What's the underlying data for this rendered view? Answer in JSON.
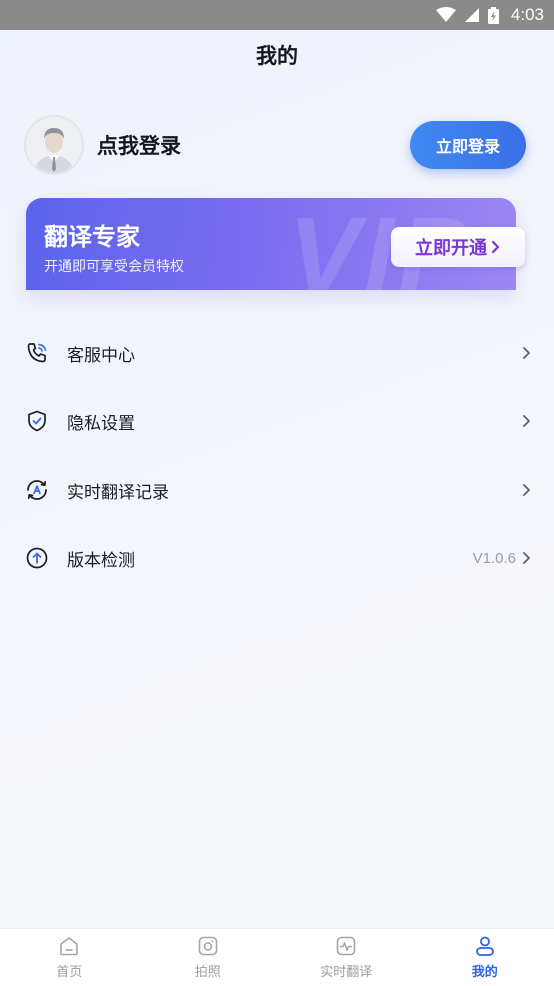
{
  "status_bar": {
    "time": "4:03"
  },
  "page": {
    "title": "我的"
  },
  "profile": {
    "login_prompt": "点我登录",
    "login_button": "立即登录"
  },
  "vip": {
    "title": "翻译专家",
    "subtitle": "开通即可享受会员特权",
    "watermark": "VIP",
    "open_button": "立即开通"
  },
  "menu": {
    "items": [
      {
        "label": "客服中心",
        "icon": "customer-service-phone-icon"
      },
      {
        "label": "隐私设置",
        "icon": "shield-check-icon"
      },
      {
        "label": "实时翻译记录",
        "icon": "translate-history-icon"
      },
      {
        "label": "版本检测",
        "icon": "upload-arrow-circle-icon",
        "value": "V1.0.6"
      }
    ]
  },
  "tabs": [
    {
      "label": "首页",
      "icon": "home-icon",
      "active": false
    },
    {
      "label": "拍照",
      "icon": "camera-icon",
      "active": false
    },
    {
      "label": "实时翻译",
      "icon": "realtime-translate-icon",
      "active": false
    },
    {
      "label": "我的",
      "icon": "user-icon",
      "active": true
    }
  ],
  "colors": {
    "accent": "#3b6fe6",
    "vip_button_text": "#7a35d6"
  }
}
